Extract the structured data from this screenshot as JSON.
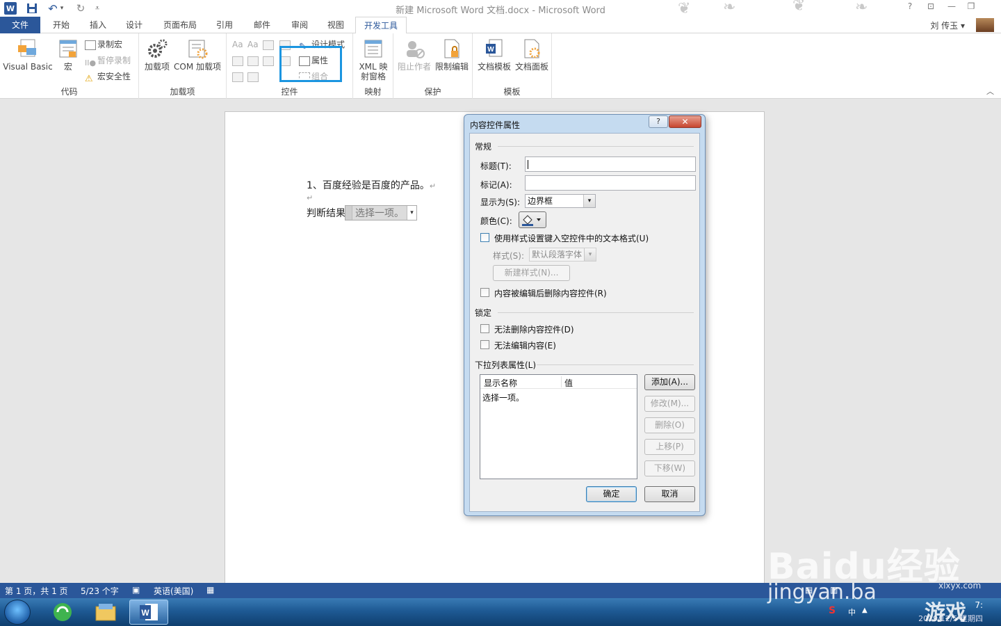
{
  "window": {
    "title": "新建 Microsoft Word 文档.docx - Microsoft Word",
    "user_name": "刘 传玉",
    "user_chevron": "▾",
    "controls": {
      "help": "?",
      "ribbon_options": "⊡",
      "minimize": "—",
      "restore": "❐"
    }
  },
  "quick_access": {
    "word_icon": "W",
    "save_icon": "save-icon",
    "undo_icon": "↶",
    "undo_drop": "▾",
    "redo_icon": "↻",
    "customize_icon": "⩡"
  },
  "ribbon": {
    "tabs": [
      "文件",
      "开始",
      "插入",
      "设计",
      "页面布局",
      "引用",
      "邮件",
      "审阅",
      "视图",
      "开发工具"
    ],
    "active_tab": "开发工具",
    "groups": {
      "code": {
        "label": "代码",
        "visual_basic": "Visual Basic",
        "macros": "宏",
        "record_macro": "录制宏",
        "pause_recording": "暂停录制",
        "macro_security": "宏安全性"
      },
      "addins": {
        "label": "加载项",
        "addins": "加载项",
        "com_addins": "COM 加载项"
      },
      "controls": {
        "label": "控件",
        "design_mode": "设计模式",
        "properties": "属性",
        "group": "组合",
        "aa1": "Aa",
        "aa2": "Aa"
      },
      "mapping": {
        "label": "映射",
        "xml_pane_line1": "XML 映",
        "xml_pane_line2": "射窗格"
      },
      "protect": {
        "label": "保护",
        "block_authors": "阻止作者",
        "restrict_editing": "限制编辑"
      },
      "templates": {
        "label": "模板",
        "document_template": "文档模板",
        "document_panel": "文档面板"
      }
    },
    "collapse_icon": "︿"
  },
  "document": {
    "line1": "1、百度经验是百度的产品。",
    "pilcrow": "↵",
    "line3_label": "判断结果",
    "dropdown_placeholder": "选择一项。",
    "dropdown_arrow": "▾"
  },
  "dialog": {
    "title": "内容控件属性",
    "help": "?",
    "close": "✕",
    "section_general": "常规",
    "title_label": "标题(T):",
    "title_value": "",
    "tag_label": "标记(A):",
    "tag_value": "",
    "show_as_label": "显示为(S):",
    "show_as_value": "边界框",
    "color_label": "颜色(C):",
    "use_style_label": "使用样式设置键入空控件中的文本格式(U)",
    "use_style_checked": false,
    "style_label": "样式(S):",
    "style_value": "默认段落字体",
    "new_style_button": "新建样式(N)...",
    "remove_when_edited_label": "内容被编辑后删除内容控件(R)",
    "section_locking": "锁定",
    "cannot_delete_label": "无法删除内容控件(D)",
    "cannot_edit_label": "无法编辑内容(E)",
    "section_dropdown": "下拉列表属性(L)",
    "list_header_display": "显示名称",
    "list_header_value": "值",
    "list_items": [
      "选择一项。"
    ],
    "add_button": "添加(A)...",
    "modify_button": "修改(M)...",
    "delete_button": "删除(O)",
    "move_up_button": "上移(P)",
    "move_down_button": "下移(W)",
    "ok_button": "确定",
    "cancel_button": "取消",
    "combo_arrow": "▾"
  },
  "statusbar": {
    "page": "第 1 页，共 1 页",
    "words": "5/23 个字",
    "language": "英语(美国)"
  },
  "taskbar": {
    "time": "7:",
    "date": "2019/12/5 星期四",
    "tray_label": "中"
  },
  "watermark": {
    "baidu": "Baidu经验",
    "jingyan": "jingyan.ba",
    "game": "游戏",
    "site": "xlxyx.com"
  },
  "colors": {
    "word_blue": "#2b579a",
    "highlight_box": "#1b95e0",
    "dialog_frame": "#c5dbf0"
  }
}
